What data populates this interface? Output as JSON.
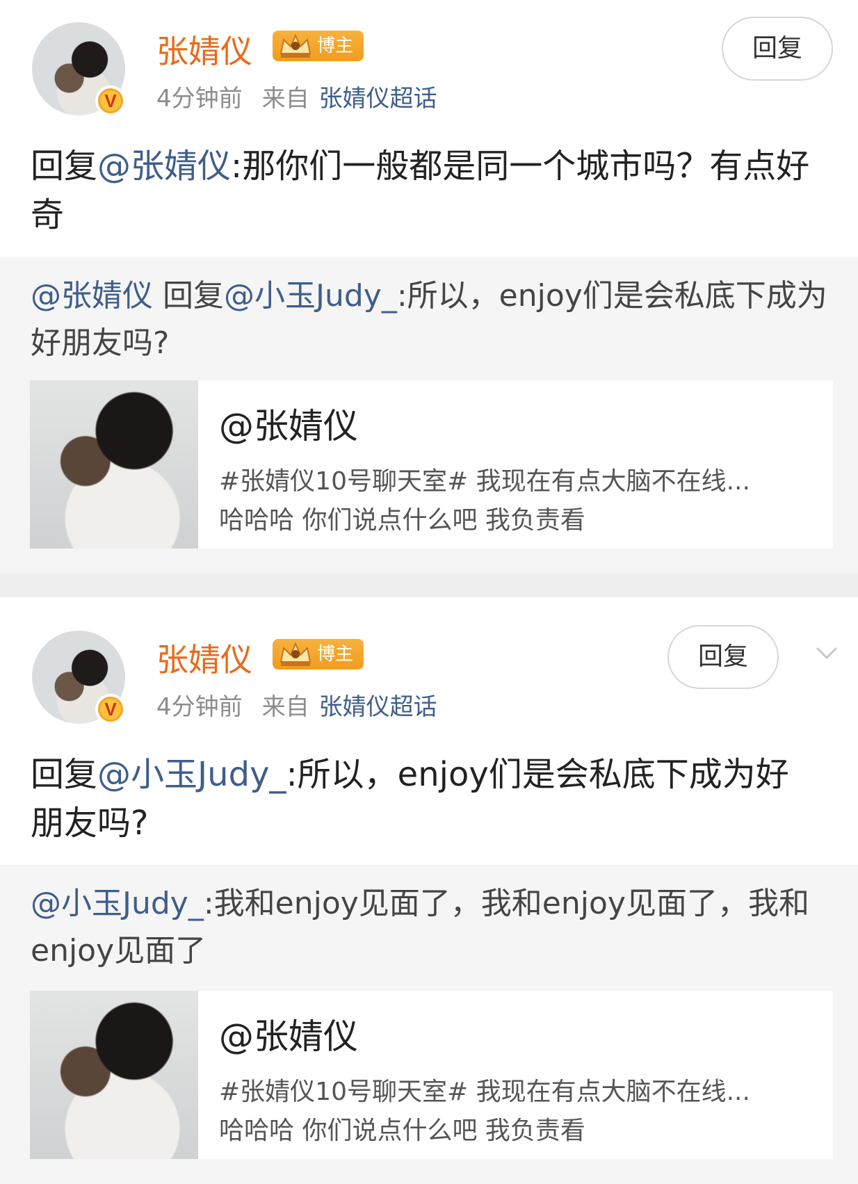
{
  "posts": [
    {
      "username": "张婧仪",
      "badge": "博主",
      "time": "4分钟前",
      "from_label": "来自",
      "source": "张婧仪超话",
      "reply_button": "回复",
      "content_prefix": "回复",
      "content_mention": "@张婧仪",
      "content_text": ":那你们一般都是同一个城市吗？有点好奇",
      "quote_mention": "@张婧仪",
      "quote_mid": " 回复",
      "quote_mention2": "@小玉Judy_",
      "quote_text": ":所以，enjoy们是会私底下成为好朋友吗?",
      "card_title": "@张婧仪",
      "card_desc_line1": "#张婧仪10号聊天室# 我现在有点大脑不在线...",
      "card_desc_line2": "哈哈哈 你们说点什么吧 我负责看"
    },
    {
      "username": "张婧仪",
      "badge": "博主",
      "time": "4分钟前",
      "from_label": "来自",
      "source": "张婧仪超话",
      "reply_button": "回复",
      "content_prefix": "回复",
      "content_mention": "@小玉Judy_",
      "content_text": ":所以，enjoy们是会私底下成为好朋友吗?",
      "quote_mention": "@小玉Judy_",
      "quote_text": ":我和enjoy见面了，我和enjoy见面了，我和enjoy见面了",
      "card_title": "@张婧仪",
      "card_desc_line1": "#张婧仪10号聊天室# 我现在有点大脑不在线...",
      "card_desc_line2": "哈哈哈 你们说点什么吧 我负责看"
    }
  ],
  "icons": {
    "verified": "v-badge-icon",
    "crown": "crown-icon",
    "chevron": "chevron-down-icon"
  },
  "colors": {
    "username": "#e86a1a",
    "link": "#3e5e8a",
    "badge": "#f39c1e"
  }
}
